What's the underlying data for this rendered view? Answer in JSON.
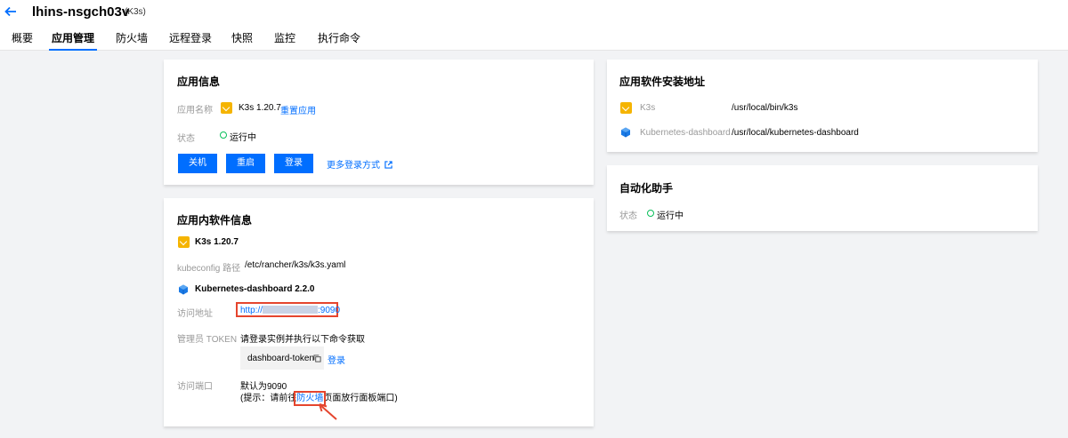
{
  "header": {
    "title": "lhins-nsgch03v",
    "subtitle": "(K3s)",
    "tabs": [
      "概要",
      "应用管理",
      "防火墙",
      "远程登录",
      "快照",
      "监控",
      "执行命令"
    ],
    "active_tab": "应用管理"
  },
  "app_info": {
    "title": "应用信息",
    "name_label": "应用名称",
    "name_value": "K3s 1.20.7",
    "reset_link": "重置应用",
    "status_label": "状态",
    "status_value": "运行中",
    "buttons": [
      "关机",
      "重启",
      "登录"
    ],
    "more_login": "更多登录方式"
  },
  "software_info": {
    "title": "应用内软件信息",
    "k3s_name": "K3s 1.20.7",
    "kubeconfig_label": "kubeconfig 路径",
    "kubeconfig_value": "/etc/rancher/k3s/k3s.yaml",
    "kd_name": "Kubernetes-dashboard 2.2.0",
    "access_label": "访问地址",
    "access_prefix": "http://",
    "access_suffix": ":9090",
    "token_label": "管理员 TOKEN",
    "token_hint": "请登录实例并执行以下命令获取",
    "token_command": "dashboard-token",
    "token_login": "登录",
    "port_label": "访问端口",
    "port_value": "默认为9090",
    "port_hint_prefix": "(提示：请前往",
    "port_hint_link": "防火墙",
    "port_hint_suffix": "页面放行面板端口)"
  },
  "install_paths": {
    "title": "应用软件安装地址",
    "items": [
      {
        "name": "K3s",
        "path": "/usr/local/bin/k3s"
      },
      {
        "name": "Kubernetes-dashboard",
        "path": "/usr/local/kubernetes-dashboard"
      }
    ]
  },
  "automation": {
    "title": "自动化助手",
    "status_label": "状态",
    "status_value": "运行中"
  },
  "colors": {
    "accent": "#006eff",
    "success": "#0abf5b",
    "annotation": "#e5452e",
    "k3s": "#f5b400"
  }
}
